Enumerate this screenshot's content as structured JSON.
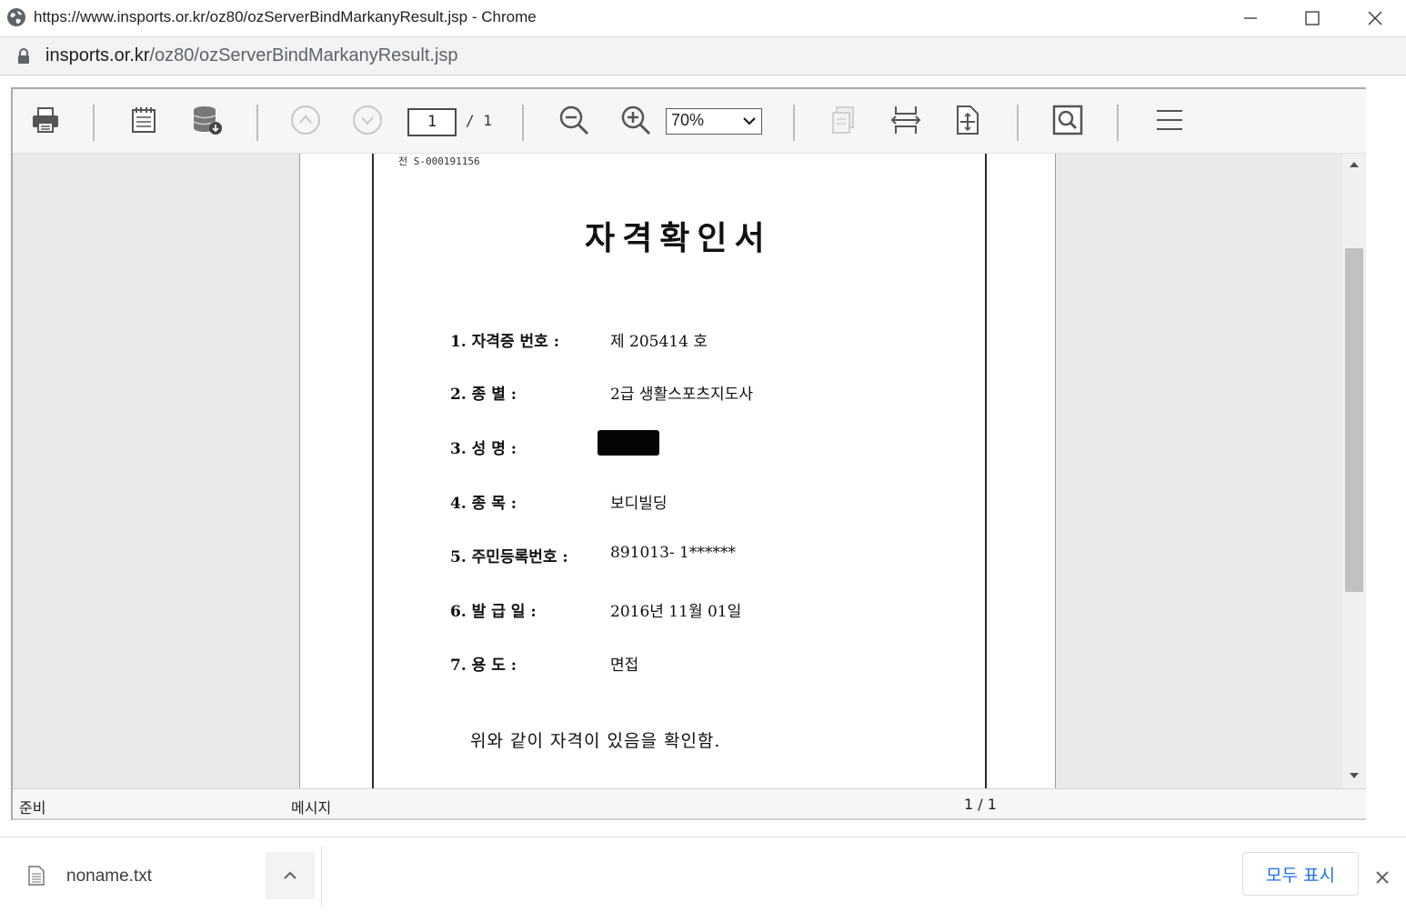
{
  "window": {
    "title": "https://www.insports.or.kr/oz80/ozServerBindMarkanyResult.jsp - Chrome"
  },
  "address_bar": {
    "host": "insports.or.kr",
    "path": "/oz80/ozServerBindMarkanyResult.jsp"
  },
  "toolbar": {
    "icons": [
      "printer-icon",
      "page-setup-icon",
      "export-icon",
      "previous-page-icon",
      "next-page-icon",
      "zoom-out-icon",
      "zoom-in-icon",
      "single-page-icon",
      "fit-width-icon",
      "fit-page-icon",
      "find-icon",
      "menu-icon"
    ],
    "page_current": "1",
    "page_total": "/ 1",
    "zoom": "70%"
  },
  "document": {
    "doc_number": "전 S-000191156",
    "title": "자격확인서",
    "fields": [
      {
        "label": "1. 자격증  번호 :",
        "value": "제 205414 호"
      },
      {
        "label": "2. 종          별 :",
        "value": "2급 생활스포츠지도사"
      },
      {
        "label": "3. 성          명 :",
        "value": ""
      },
      {
        "label": "4. 종          목 :",
        "value": "보디빌딩"
      },
      {
        "label": "5. 주민등록번호 :",
        "value": "891013- 1******"
      },
      {
        "label": "6. 발    급    일 :",
        "value": "2016년 11월 01일"
      },
      {
        "label": "7. 용          도 :",
        "value": "면접"
      }
    ],
    "confirmation": "위와 같이 자격이 있음을 확인함."
  },
  "status_bar": {
    "state": "준비",
    "message": "메시지",
    "page": "1 / 1"
  },
  "downloads": {
    "filename": "noname.txt",
    "show_all": "모두 표시"
  }
}
